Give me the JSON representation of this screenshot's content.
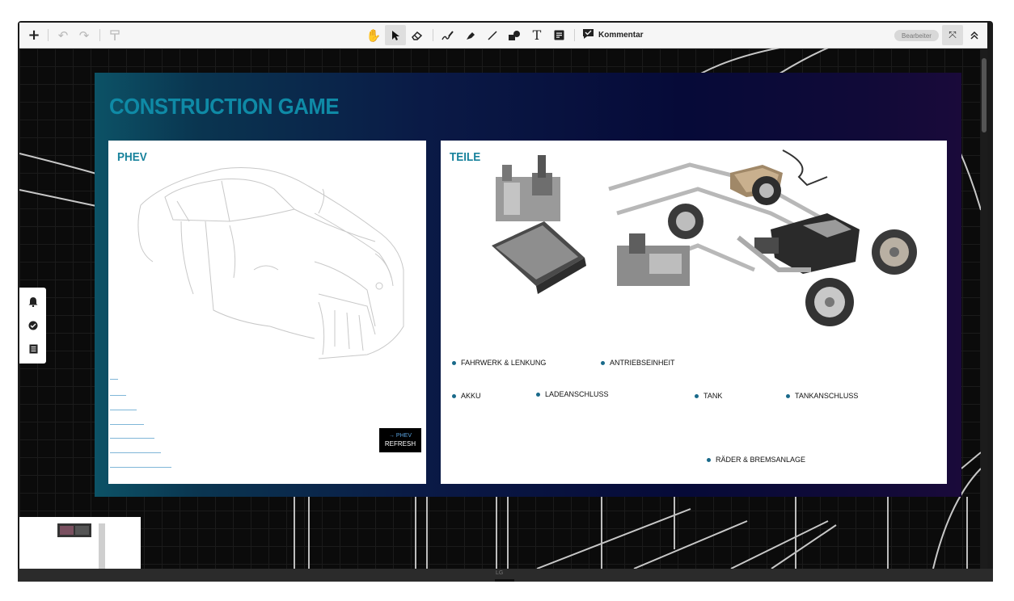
{
  "toolbar": {
    "kommentar_label": "Kommentar",
    "role_badge": "Bearbeiter",
    "tools": [
      "add-icon",
      "undo-icon",
      "redo-icon",
      "paint-roller-icon",
      "hand-icon",
      "pointer-icon",
      "eraser-icon",
      "pen-icon",
      "highlighter-icon",
      "line-icon",
      "shapes-icon",
      "text-icon",
      "sticky-note-icon"
    ]
  },
  "slide": {
    "title": "CONSTRUCTION GAME",
    "left_panel": {
      "title": "PHEV",
      "refresh_line1": "→ PHEV",
      "refresh_line2": "REFRESH"
    },
    "right_panel": {
      "title": "TEILE",
      "parts": [
        "FAHRWERK & LENKUNG",
        "ANTRIEBSEINHEIT",
        "AKKU",
        "LADEANSCHLUSS",
        "TANK",
        "TANKANSCHLUSS",
        "RÄDER & BREMSANLAGE"
      ]
    }
  },
  "sidebar": {
    "icons": [
      "bell-icon",
      "check-circle-icon",
      "document-list-icon"
    ]
  },
  "bezel": {
    "logo": "LG"
  }
}
